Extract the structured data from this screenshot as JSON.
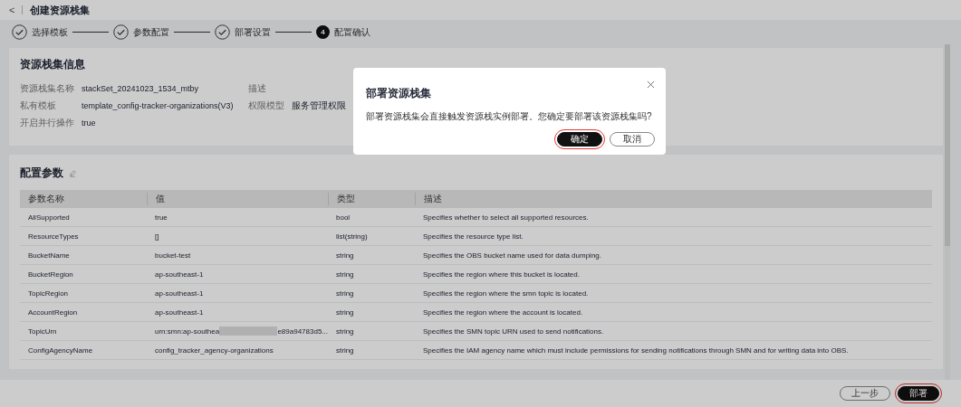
{
  "header": {
    "back": "<",
    "title": "创建资源栈集"
  },
  "steps": [
    {
      "label": "选择模板",
      "done": true
    },
    {
      "label": "参数配置",
      "done": true
    },
    {
      "label": "部署设置",
      "done": true
    },
    {
      "label": "配置确认",
      "done": false,
      "number": "4"
    }
  ],
  "info": {
    "title": "资源栈集信息",
    "fields": [
      {
        "label": "资源栈集名称",
        "value": "stackSet_20241023_1534_mtby"
      },
      {
        "label": "描述"
      },
      {
        "label": "私有模板",
        "value": "template_config-tracker-organizations(V3)"
      },
      {
        "label": "权限模型",
        "value": "服务管理权限"
      },
      {
        "label": "开启并行操作",
        "value": "true"
      }
    ]
  },
  "params": {
    "title": "配置参数",
    "columns": [
      "参数名称",
      "值",
      "类型",
      "描述"
    ],
    "rows": [
      {
        "name": "AllSupported",
        "value_parts": [
          "true"
        ],
        "type": "bool",
        "description": "Specifies whether to select all supported resources."
      },
      {
        "name": "ResourceTypes",
        "value_parts": [
          "[]"
        ],
        "type": "list(string)",
        "description": "Specifies the resource type list."
      },
      {
        "name": "BucketName",
        "value_parts": [
          "bucket-test"
        ],
        "type": "string",
        "description": "Specifies the OBS bucket name used for data dumping."
      },
      {
        "name": "BucketRegion",
        "value_parts": [
          "ap-southeast-1"
        ],
        "type": "string",
        "description": "Specifies the region where this bucket is located."
      },
      {
        "name": "TopicRegion",
        "value_parts": [
          "ap-southeast-1"
        ],
        "type": "string",
        "description": "Specifies the region where the smn topic is located."
      },
      {
        "name": "AccountRegion",
        "value_parts": [
          "ap-southeast-1"
        ],
        "type": "string",
        "description": "Specifies the region where the account is located."
      },
      {
        "name": "TopicUrn",
        "value_parts": [
          "urn:smn:ap-southea",
          "e89a94783d5..."
        ],
        "type": "string",
        "description": "Specifies the SMN topic URN used to send notifications."
      },
      {
        "name": "ConfigAgencyName",
        "value_parts": [
          "config_tracker_agency-organizations"
        ],
        "type": "string",
        "description": "Specifies the IAM agency name which must include permissions for sending notifications through SMN and for writing data into OBS."
      }
    ]
  },
  "footer": {
    "buttons": [
      {
        "label": "上一步",
        "kind": "secondary",
        "highlighted": false
      },
      {
        "label": "部署",
        "kind": "primary",
        "highlighted": true
      }
    ]
  },
  "dialog": {
    "title": "部署资源栈集",
    "message": "部署资源栈集会直接触发资源栈实例部署。您确定要部署该资源栈集吗?",
    "buttons": [
      {
        "label": "确定",
        "kind": "primary",
        "highlighted": true
      },
      {
        "label": "取消",
        "kind": "secondary",
        "highlighted": false
      }
    ]
  }
}
